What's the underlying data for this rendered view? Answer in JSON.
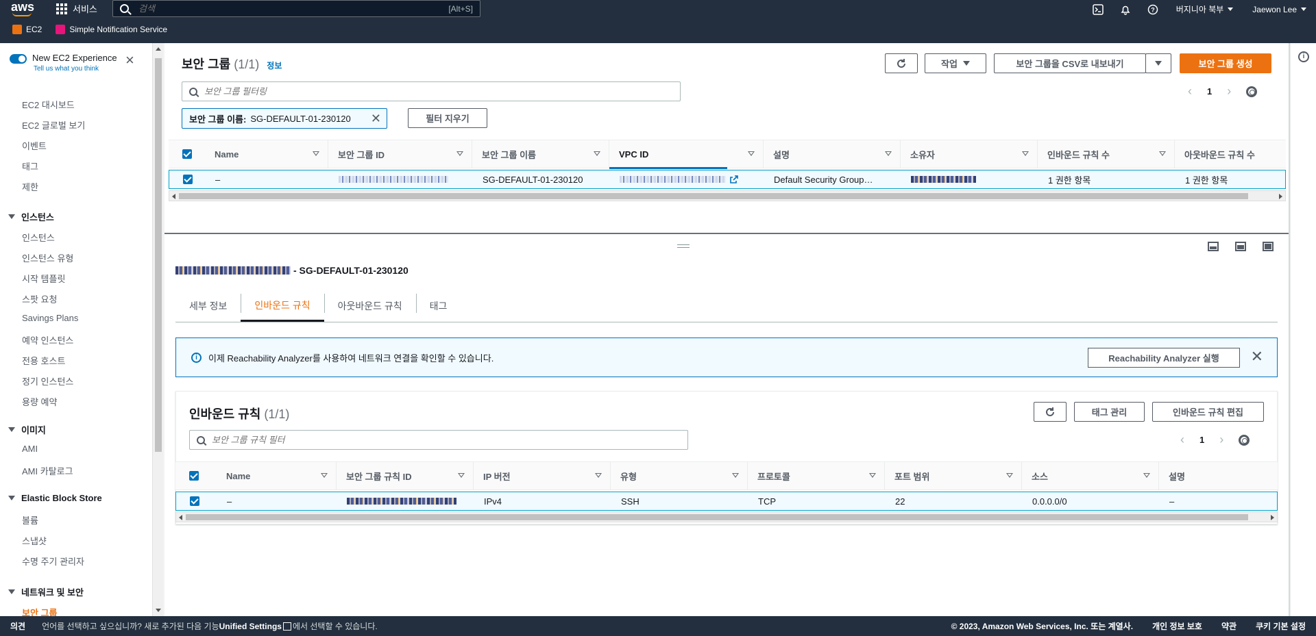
{
  "topnav": {
    "logo": "aws",
    "services": "서비스",
    "search_placeholder": "검색",
    "search_shortcut": "[Alt+S]",
    "region": "버지니아 북부",
    "user": "Jaewon Lee"
  },
  "favorites": [
    {
      "label": "EC2",
      "color": "#ec7211"
    },
    {
      "label": "Simple Notification Service",
      "color": "#e7157b"
    }
  ],
  "sidebar": {
    "experience_label": "New EC2 Experience",
    "experience_sub": "Tell us what you think",
    "top_items": [
      "EC2 대시보드",
      "EC2 글로벌 보기",
      "이벤트",
      "태그",
      "제한"
    ],
    "sections": [
      {
        "title": "인스턴스",
        "items": [
          "인스턴스",
          "인스턴스 유형",
          "시작 템플릿",
          "스팟 요청",
          "Savings Plans",
          "예약 인스턴스",
          "전용 호스트",
          "정기 인스턴스",
          "용량 예약"
        ]
      },
      {
        "title": "이미지",
        "items": [
          "AMI",
          "AMI 카탈로그"
        ]
      },
      {
        "title": "Elastic Block Store",
        "items": [
          "볼륨",
          "스냅샷",
          "수명 주기 관리자"
        ]
      },
      {
        "title": "네트워크 및 보안",
        "items": [
          "보안 그룹"
        ]
      }
    ],
    "active": "보안 그룹"
  },
  "sg_pane": {
    "title": "보안 그룹",
    "count": "(1/1)",
    "info": "정보",
    "actions_label": "작업",
    "export_label": "보안 그룹을 CSV로 내보내기",
    "create_label": "보안 그룹 생성",
    "filter_placeholder": "보안 그룹 필터링",
    "token_key": "보안 그룹 이름:",
    "token_value": "SG-DEFAULT-01-230120",
    "clear_label": "필터 지우기",
    "page": "1",
    "columns": [
      "Name",
      "보안 그룹 ID",
      "보안 그룹 이름",
      "VPC ID",
      "설명",
      "소유자",
      "인바운드 규칙 수",
      "아웃바운드 규칙 수"
    ],
    "row": {
      "name": "–",
      "sg_name": "SG-DEFAULT-01-230120",
      "description": "Default Security Group…",
      "inbound": "1 권한 항목",
      "outbound": "1 권한 항목"
    }
  },
  "detail": {
    "title_suffix": "- SG-DEFAULT-01-230120",
    "tabs": [
      "세부 정보",
      "인바운드 규칙",
      "아웃바운드 규칙",
      "태그"
    ],
    "active_tab": "인바운드 규칙",
    "alert_text": "이제 Reachability Analyzer를 사용하여 네트워크 연결을 확인할 수 있습니다.",
    "alert_button": "Reachability Analyzer 실행"
  },
  "inbound": {
    "title": "인바운드 규칙",
    "count": "(1/1)",
    "manage_tags": "태그 관리",
    "edit_rules": "인바운드 규칙 편집",
    "filter_placeholder": "보안 그룹 규칙 필터",
    "page": "1",
    "columns": [
      "Name",
      "보안 그룹 규칙 ID",
      "IP 버전",
      "유형",
      "프로토콜",
      "포트 범위",
      "소스",
      "설명"
    ],
    "row": {
      "name": "–",
      "ip_version": "IPv4",
      "type": "SSH",
      "protocol": "TCP",
      "port": "22",
      "source": "0.0.0.0/0",
      "description": "–"
    }
  },
  "footer": {
    "feedback": "의견",
    "lang_prefix": "언어를 선택하고 싶으십니까? 새로 추가된 다음 기능",
    "lang_link": "Unified Settings",
    "lang_suffix": "에서 선택할 수 있습니다.",
    "copyright": "© 2023, Amazon Web Services, Inc. 또는 계열사.",
    "privacy": "개인 정보 보호",
    "terms": "약관",
    "cookies": "쿠키 기본 설정"
  }
}
